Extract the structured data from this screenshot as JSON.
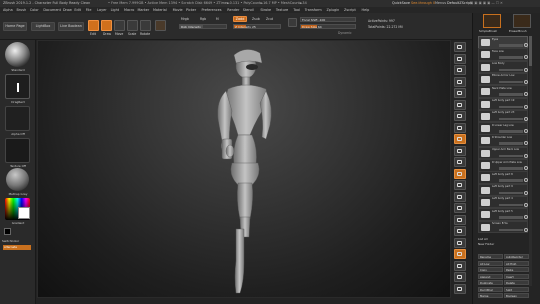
{
  "title_bar": {
    "app_title": "ZBrush 2019.1.2 - Character Full Body Ready Clean",
    "memory_info": "• Free Mem 7.999GB • Active Mem 1394 • Scratch Disk 6649 • ZTime►0.131 • PolyCount►16.7 MP • MeshCount►34",
    "quicksave": "QuickSave",
    "seethrough": "See-through 0",
    "menus": "Menus",
    "script": "DefaultZScript"
  },
  "menu_bar": [
    "Alpha",
    "Brush",
    "Color",
    "Document",
    "Draw",
    "Edit",
    "File",
    "Layer",
    "Light",
    "Macro",
    "Marker",
    "Material",
    "Movie",
    "Picker",
    "Preferences",
    "Render",
    "Stencil",
    "Stroke",
    "Texture",
    "Tool",
    "Transform",
    "Zplugin",
    "Zscript",
    "Help"
  ],
  "toolbar": {
    "home_page": "Home Page",
    "lightbox": "LightBox",
    "live_boolean": "Live Boolean",
    "edit": "Edit",
    "draw": "Draw",
    "move": "Move",
    "scale": "Scale",
    "rotate": "Rotate",
    "mrgb": "Mrgb",
    "rgb": "Rgb",
    "m": "M",
    "rgb_intensity": "Rgb Intensity",
    "zadd": "Zadd",
    "zsub": "Zsub",
    "zcut": "Zcut",
    "z_intensity": "Z Intensity 25",
    "focal_shift": "Focal Shift -100",
    "draw_size": "Draw Size 64",
    "dynamic": "Dynamic",
    "active_points": "ActivePoints: 997",
    "total_points": "TotalPoints: 22.272 Mil"
  },
  "left_shelf": {
    "brush_label": "Standard",
    "stroke_label": "DragRect",
    "alpha_label": "Alpha Off",
    "texture_label": "Texture Off",
    "material_label": "MatCap Gray",
    "gradient_label": "Gradient",
    "switch_color": "SwitchColor",
    "alternate": "Alternate"
  },
  "right_icons": [
    "BPR",
    "SPix 3",
    "Scroll",
    "Zoom",
    "Actual",
    "AAHalf",
    "Dynamic",
    "Persp",
    "Floor",
    "Local",
    "L.Sym",
    "Xyz",
    "Frame",
    "Move",
    "Zoom3D",
    "Rotate",
    "Line Fill",
    "PolyF",
    "Transp",
    "Ghost",
    "Solo",
    "Xpose"
  ],
  "right_panel": {
    "top_tools": [
      "SimpleBrush",
      "EraserBrush"
    ],
    "subtool_title": "Subtool",
    "visible_count": "Visible Count 34",
    "subtools": [
      "Eyes",
      "Face Low",
      "Low Body",
      "Elbow Armor Low",
      "Neck Plate Low",
      "Left body part 19",
      "Left body part 23",
      "R Lower Leg Low",
      "R Shoulder Low",
      "Upper Arm Back Low",
      "R Upper Arm Plate Low",
      "Left body part 8",
      "Left body part 9",
      "Left body part 4",
      "Left body part 5",
      "Screen B 5a"
    ],
    "list_all": "List All",
    "new_folder": "New Folder",
    "bottom_buttons": [
      "Rename",
      "AutoReorder",
      "All Low",
      "All High",
      "Copy",
      "Paste",
      "Append",
      "Insert",
      "Duplicate",
      "Delete",
      "Del Other",
      "Split",
      "Merge",
      "Boolean"
    ],
    "active_index": 0
  }
}
